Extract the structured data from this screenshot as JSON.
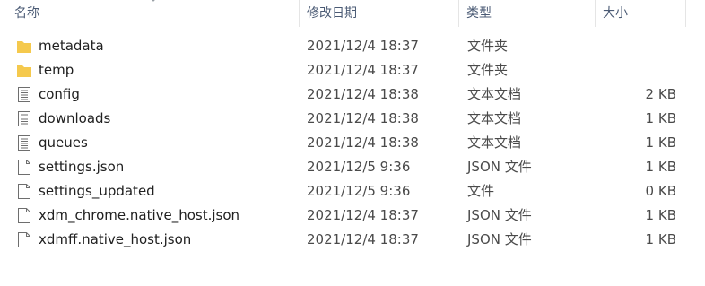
{
  "columns": {
    "name": "名称",
    "date": "修改日期",
    "type": "类型",
    "size": "大小"
  },
  "rows": [
    {
      "name": "metadata",
      "date": "2021/12/4 18:37",
      "type": "文件夹",
      "size": "",
      "icon": "folder-icon"
    },
    {
      "name": "temp",
      "date": "2021/12/4 18:37",
      "type": "文件夹",
      "size": "",
      "icon": "folder-icon"
    },
    {
      "name": "config",
      "date": "2021/12/4 18:38",
      "type": "文本文档",
      "size": "2 KB",
      "icon": "text-document-icon"
    },
    {
      "name": "downloads",
      "date": "2021/12/4 18:38",
      "type": "文本文档",
      "size": "1 KB",
      "icon": "text-document-icon"
    },
    {
      "name": "queues",
      "date": "2021/12/4 18:38",
      "type": "文本文档",
      "size": "1 KB",
      "icon": "text-document-icon"
    },
    {
      "name": "settings.json",
      "date": "2021/12/5 9:36",
      "type": "JSON 文件",
      "size": "1 KB",
      "icon": "blank-file-icon"
    },
    {
      "name": "settings_updated",
      "date": "2021/12/5 9:36",
      "type": "文件",
      "size": "0 KB",
      "icon": "blank-file-icon"
    },
    {
      "name": "xdm_chrome.native_host.json",
      "date": "2021/12/4 18:37",
      "type": "JSON 文件",
      "size": "1 KB",
      "icon": "blank-file-icon"
    },
    {
      "name": "xdmff.native_host.json",
      "date": "2021/12/4 18:37",
      "type": "JSON 文件",
      "size": "1 KB",
      "icon": "blank-file-icon"
    }
  ],
  "colors": {
    "folder": "#f4c94e",
    "header_text": "#4a5a74"
  }
}
